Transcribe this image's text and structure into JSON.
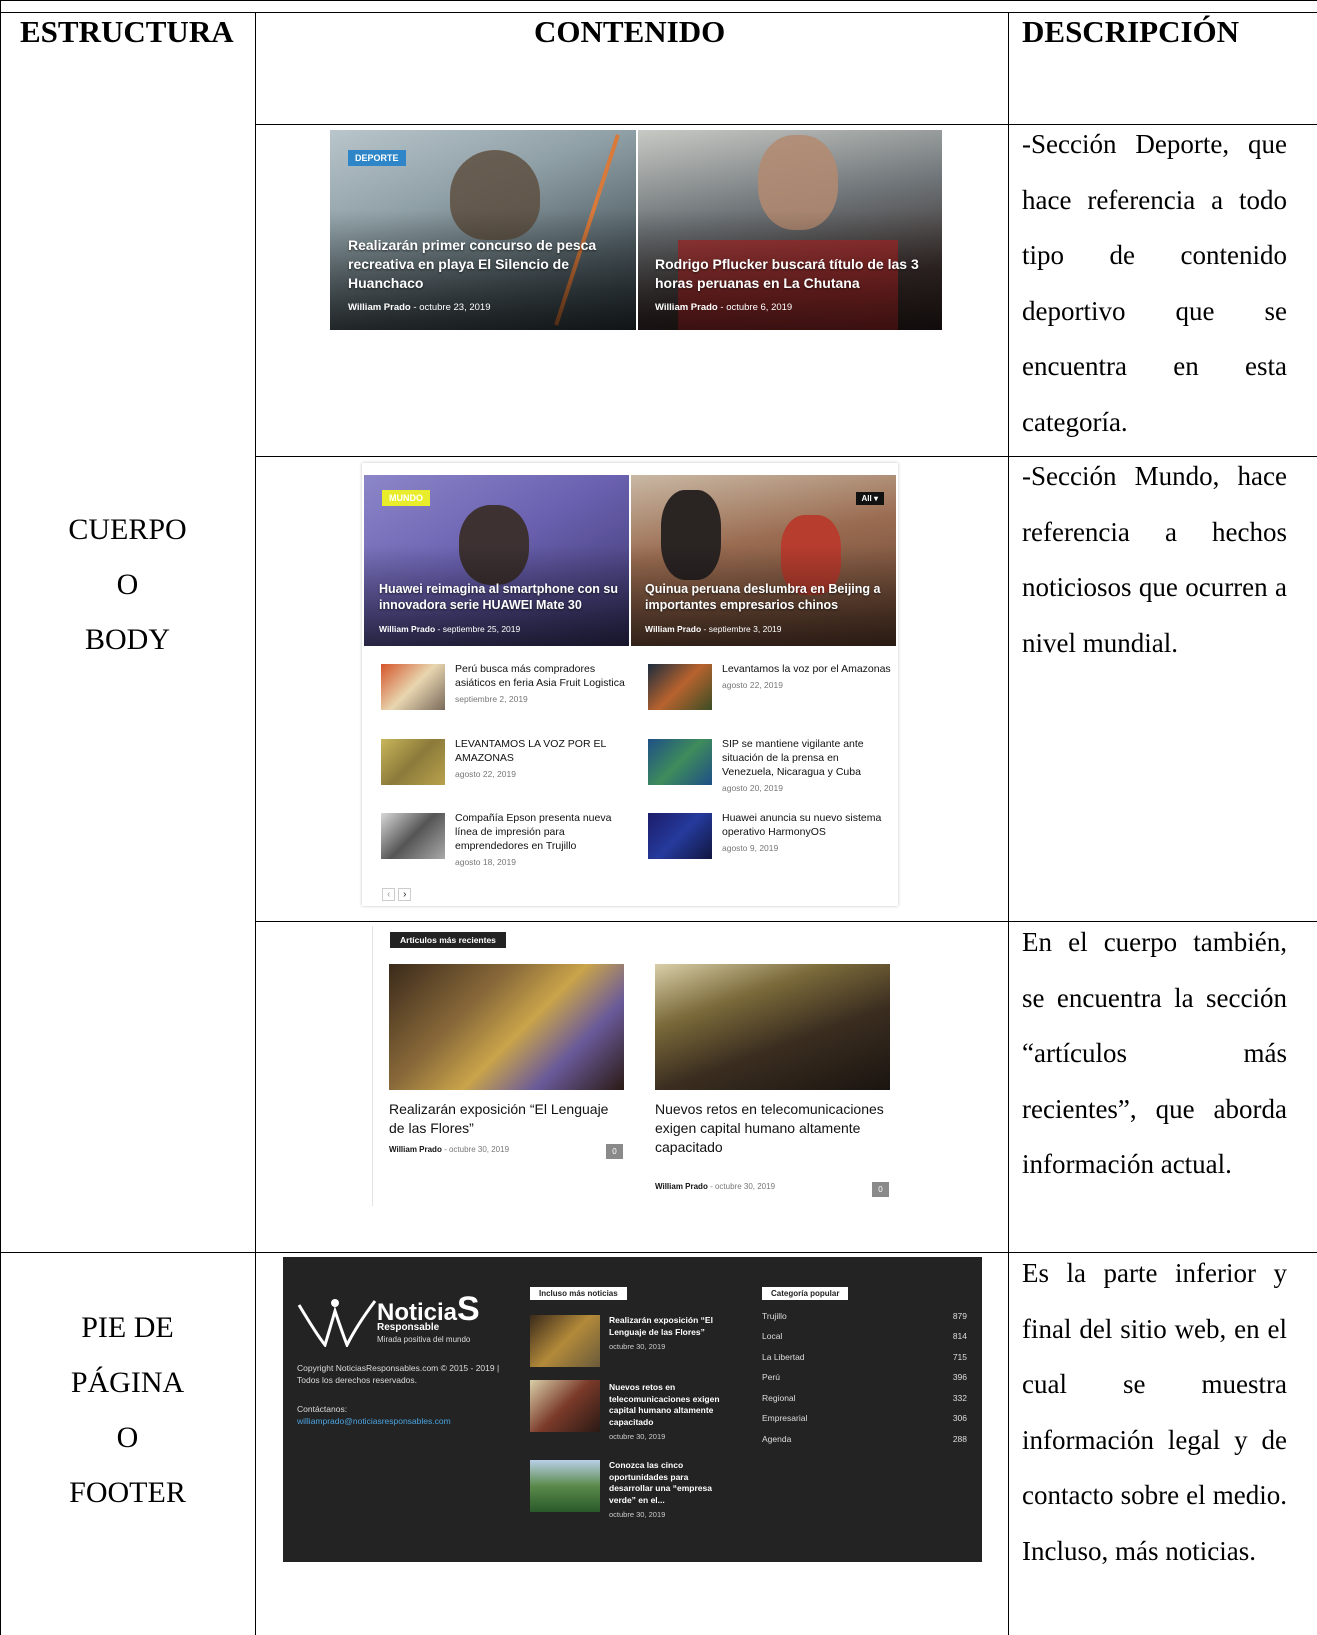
{
  "headers": {
    "estructura": "ESTRUCTURA",
    "contenido": "CONTENIDO",
    "descripcion": "DESCRIPCIÓN"
  },
  "rows": {
    "body_label": [
      "CUERPO",
      "O",
      "BODY"
    ],
    "footer_label": [
      "PIE DE",
      "PÁGINA",
      "O",
      "FOOTER"
    ]
  },
  "descriptions": {
    "deporte": "-Sección Deporte, que hace referencia a todo tipo de contenido deportivo que se encuentra en esta categoría.",
    "mundo": "-Sección Mundo, hace referencia a hechos noticiosos que ocurren a nivel mundial.",
    "recientes": "En el cuerpo también, se encuentra la sección “artículos más recientes”, que aborda información actual.",
    "footer": "Es la parte inferior y final del sitio web, en el cual se muestra información legal y de contacto sobre el medio. Incluso, más noticias."
  },
  "deporte": {
    "badge": "DEPORTE",
    "cards": [
      {
        "title": "Realizarán primer concurso de pesca recreativa en playa El Silencio de Huanchaco",
        "author": "William Prado",
        "sep": "-",
        "date": "octubre 23, 2019"
      },
      {
        "title": "Rodrigo Pflucker buscará título de las 3 horas peruanas en La Chutana",
        "author": "William Prado",
        "sep": "-",
        "date": "octubre 6, 2019"
      }
    ]
  },
  "mundo": {
    "badge": "MUNDO",
    "filter": "All",
    "cards": [
      {
        "title": "Huawei reimagina al smartphone con su innovadora serie HUAWEI Mate 30",
        "author": "William Prado",
        "sep": "-",
        "date": "septiembre 25, 2019"
      },
      {
        "title": "Quinua peruana deslumbra en Beijing a importantes empresarios chinos",
        "author": "William Prado",
        "sep": "-",
        "date": "septiembre 3, 2019"
      }
    ],
    "list": [
      {
        "title": "Perú busca más compradores asiáticos en feria Asia Fruit Logistica",
        "date": "septiembre 2, 2019"
      },
      {
        "title": "Levantamos la voz por el Amazonas",
        "date": "agosto 22, 2019"
      },
      {
        "title": "LEVANTAMOS LA VOZ POR EL AMAZONAS",
        "date": "agosto 22, 2019"
      },
      {
        "title": "SIP se mantiene vigilante ante situación de la prensa en Venezuela, Nicaragua y Cuba",
        "date": "agosto 20, 2019"
      },
      {
        "title": "Compañía Epson presenta nueva línea de impresión para emprendedores en Trujillo",
        "date": "agosto 18, 2019"
      },
      {
        "title": "Huawei anuncia su nuevo sistema operativo HarmonyOS",
        "date": "agosto 9, 2019"
      }
    ],
    "pager_prev": "‹",
    "pager_next": "›"
  },
  "recientes": {
    "tag": "Artículos más recientes",
    "cards": [
      {
        "title": "Realizarán exposición “El Lenguaje de las Flores”",
        "author": "William Prado",
        "sep": "-",
        "date": "octubre 30, 2019",
        "comments": "0"
      },
      {
        "title": "Nuevos retos en telecomunicaciones exigen capital humano altamente capacitado",
        "author": "William Prado",
        "sep": "-",
        "date": "octubre 30, 2019",
        "comments": "0"
      }
    ]
  },
  "footer": {
    "logo_main": "Noticia",
    "logo_s": "S",
    "logo_sub": "Responsable",
    "logo_tagline": "Mirada positiva del mundo",
    "copyright": "Copyright NoticiasResponsables.com © 2015 - 2019 | Todos los derechos reservados.",
    "contact_label": "Contáctanos:",
    "contact_email": "williamprado@noticiasresponsables.com",
    "more_tag": "Incluso más noticias",
    "more": [
      {
        "title": "Realizarán exposición “El Lenguaje de las Flores”",
        "date": "octubre 30, 2019"
      },
      {
        "title": "Nuevos retos en telecomunicaciones exigen capital humano altamente capacitado",
        "date": "octubre 30, 2019"
      },
      {
        "title": "Conozca las cinco oportunidades para desarrollar una “empresa verde” en el...",
        "date": "octubre 30, 2019"
      }
    ],
    "cat_tag": "Categoría popular",
    "categories": [
      {
        "name": "Trujillo",
        "count": "879"
      },
      {
        "name": "Local",
        "count": "814"
      },
      {
        "name": "La Libertad",
        "count": "715"
      },
      {
        "name": "Perú",
        "count": "396"
      },
      {
        "name": "Regional",
        "count": "332"
      },
      {
        "name": "Empresarial",
        "count": "306"
      },
      {
        "name": "Agenda",
        "count": "288"
      }
    ]
  },
  "colors": {
    "deporte_badge": "#2e86c8",
    "mundo_badge": "#e9ec2a",
    "footer_bg": "#232323",
    "email_link": "#4aa3df"
  }
}
